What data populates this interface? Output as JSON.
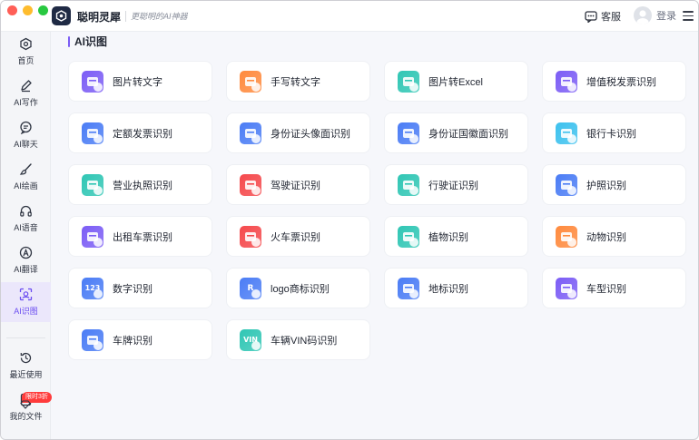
{
  "app": {
    "name": "聪明灵犀",
    "tagline": "更聪明的AI神器",
    "service_label": "客服",
    "login_label": "登录"
  },
  "sidebar": {
    "items": [
      {
        "label": "首页",
        "icon": "home-icon"
      },
      {
        "label": "AI写作",
        "icon": "pen-icon"
      },
      {
        "label": "AI聊天",
        "icon": "chat-icon"
      },
      {
        "label": "AI绘画",
        "icon": "brush-icon"
      },
      {
        "label": "AI语音",
        "icon": "headphones-icon"
      },
      {
        "label": "AI翻译",
        "icon": "translate-icon"
      },
      {
        "label": "AI识图",
        "icon": "scan-icon",
        "active": true
      }
    ],
    "bottom_items": [
      {
        "label": "最近使用",
        "icon": "history-icon"
      },
      {
        "label": "我的文件",
        "icon": "file-icon"
      }
    ],
    "promo_badge": "限时3折"
  },
  "main": {
    "section_title": "AI识图",
    "tools": [
      {
        "label": "图片转文字",
        "color": "#7b5cf5"
      },
      {
        "label": "手写转文字",
        "color": "#ff8a3d"
      },
      {
        "label": "图片转Excel",
        "color": "#2fc6b4"
      },
      {
        "label": "增值税发票识别",
        "color": "#7b5cf5"
      },
      {
        "label": "定额发票识别",
        "color": "#4a7cf5"
      },
      {
        "label": "身份证头像面识别",
        "color": "#4a7cf5"
      },
      {
        "label": "身份证国徽面识别",
        "color": "#4a7cf5"
      },
      {
        "label": "银行卡识别",
        "color": "#3cc1ee"
      },
      {
        "label": "营业执照识别",
        "color": "#2fc6b4"
      },
      {
        "label": "驾驶证识别",
        "color": "#f5484b"
      },
      {
        "label": "行驶证识别",
        "color": "#2fc6b4"
      },
      {
        "label": "护照识别",
        "color": "#4a7cf5"
      },
      {
        "label": "出租车票识别",
        "color": "#7b5cf5"
      },
      {
        "label": "火车票识别",
        "color": "#f5484b"
      },
      {
        "label": "植物识别",
        "color": "#2fc6b4"
      },
      {
        "label": "动物识别",
        "color": "#ff8a3d"
      },
      {
        "label": "数字识别",
        "color": "#4a7cf5",
        "glyph": "123"
      },
      {
        "label": "logo商标识别",
        "color": "#4a7cf5",
        "glyph": "R"
      },
      {
        "label": "地标识别",
        "color": "#4a7cf5"
      },
      {
        "label": "车型识别",
        "color": "#7b5cf5"
      },
      {
        "label": "车牌识别",
        "color": "#4a7cf5"
      },
      {
        "label": "车辆VIN码识别",
        "color": "#2fc6b4",
        "glyph": "VIN"
      }
    ]
  }
}
